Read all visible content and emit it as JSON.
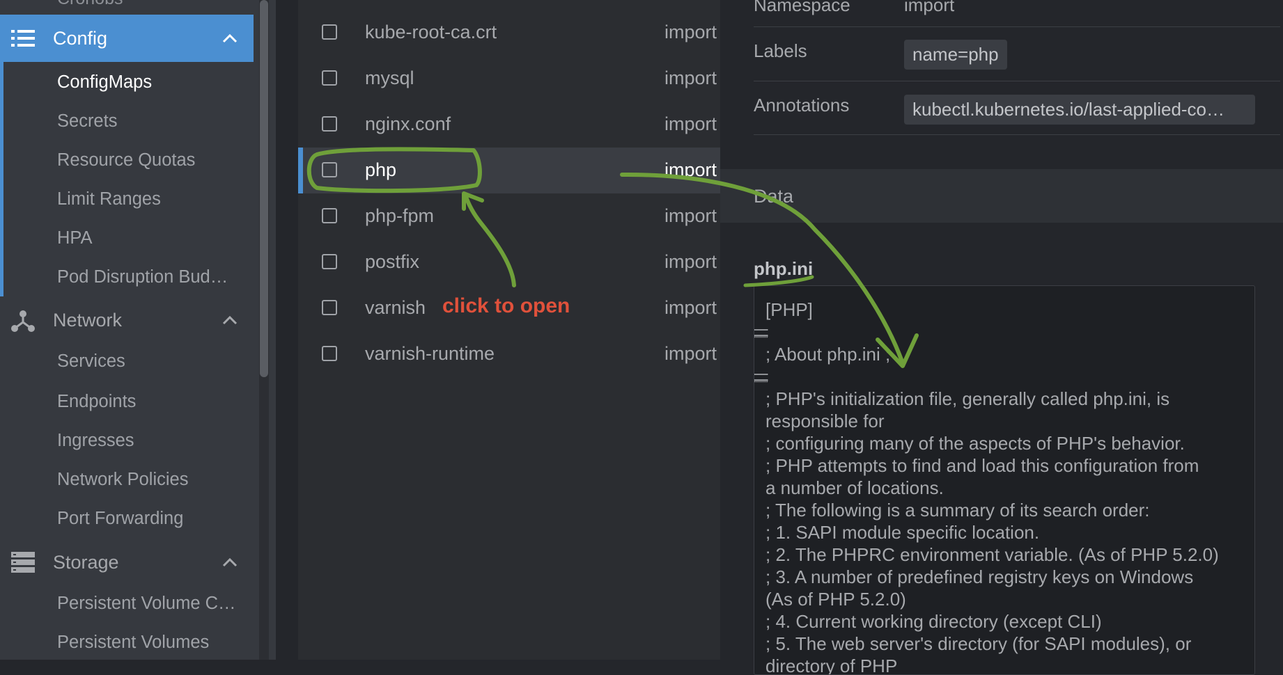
{
  "sidebar": {
    "cut_top_label": "Cronobs",
    "config": {
      "label": "Config",
      "items": [
        "ConfigMaps",
        "Secrets",
        "Resource Quotas",
        "Limit Ranges",
        "HPA",
        "Pod Disruption Bud…"
      ]
    },
    "network": {
      "label": "Network",
      "items": [
        "Services",
        "Endpoints",
        "Ingresses",
        "Network Policies",
        "Port Forwarding"
      ]
    },
    "storage": {
      "label": "Storage",
      "items": [
        "Persistent Volume C…",
        "Persistent Volumes"
      ]
    }
  },
  "list": {
    "rows": [
      {
        "name": "kube-root-ca.crt",
        "namespace": "import"
      },
      {
        "name": "mysql",
        "namespace": "import"
      },
      {
        "name": "nginx.conf",
        "namespace": "import"
      },
      {
        "name": "php",
        "namespace": "import"
      },
      {
        "name": "php-fpm",
        "namespace": "import"
      },
      {
        "name": "postfix",
        "namespace": "import"
      },
      {
        "name": "varnish",
        "namespace": "import"
      },
      {
        "name": "varnish-runtime",
        "namespace": "import"
      }
    ]
  },
  "details": {
    "namespace_label": "Namespace",
    "namespace_value": "import",
    "labels_label": "Labels",
    "labels_value": "name=php",
    "annotations_label": "Annotations",
    "annotations_value": "kubectl.kubernetes.io/last-applied-co…",
    "data_title": "Data",
    "key_name": "php.ini",
    "value_lines": [
      "[PHP]",
      ";;;;;;;;;;;;;;;;;;;",
      "; About php.ini ;",
      ";;;;;;;;;;;;;;;;;;;",
      "; PHP's initialization file, generally called php.ini, is",
      "responsible for",
      "; configuring many of the aspects of PHP's behavior.",
      "; PHP attempts to find and load this configuration from",
      "a number of locations.",
      "; The following is a summary of its search order:",
      "; 1. SAPI module specific location.",
      "; 2. The PHPRC environment variable. (As of PHP 5.2.0)",
      "; 3. A number of predefined registry keys on Windows",
      "(As of PHP 5.2.0)",
      "; 4. Current working directory (except CLI)",
      "; 5. The web server's directory (for SAPI modules), or",
      "directory of PHP"
    ]
  },
  "annotation": {
    "label": "click to open",
    "color": "#e0513b",
    "stroke_color": "#6fa03a"
  },
  "colors": {
    "accent": "#4b8fd1",
    "sidebar_bg": "#36393f",
    "list_bg": "#2b2d31",
    "details_bg": "#24262b"
  }
}
